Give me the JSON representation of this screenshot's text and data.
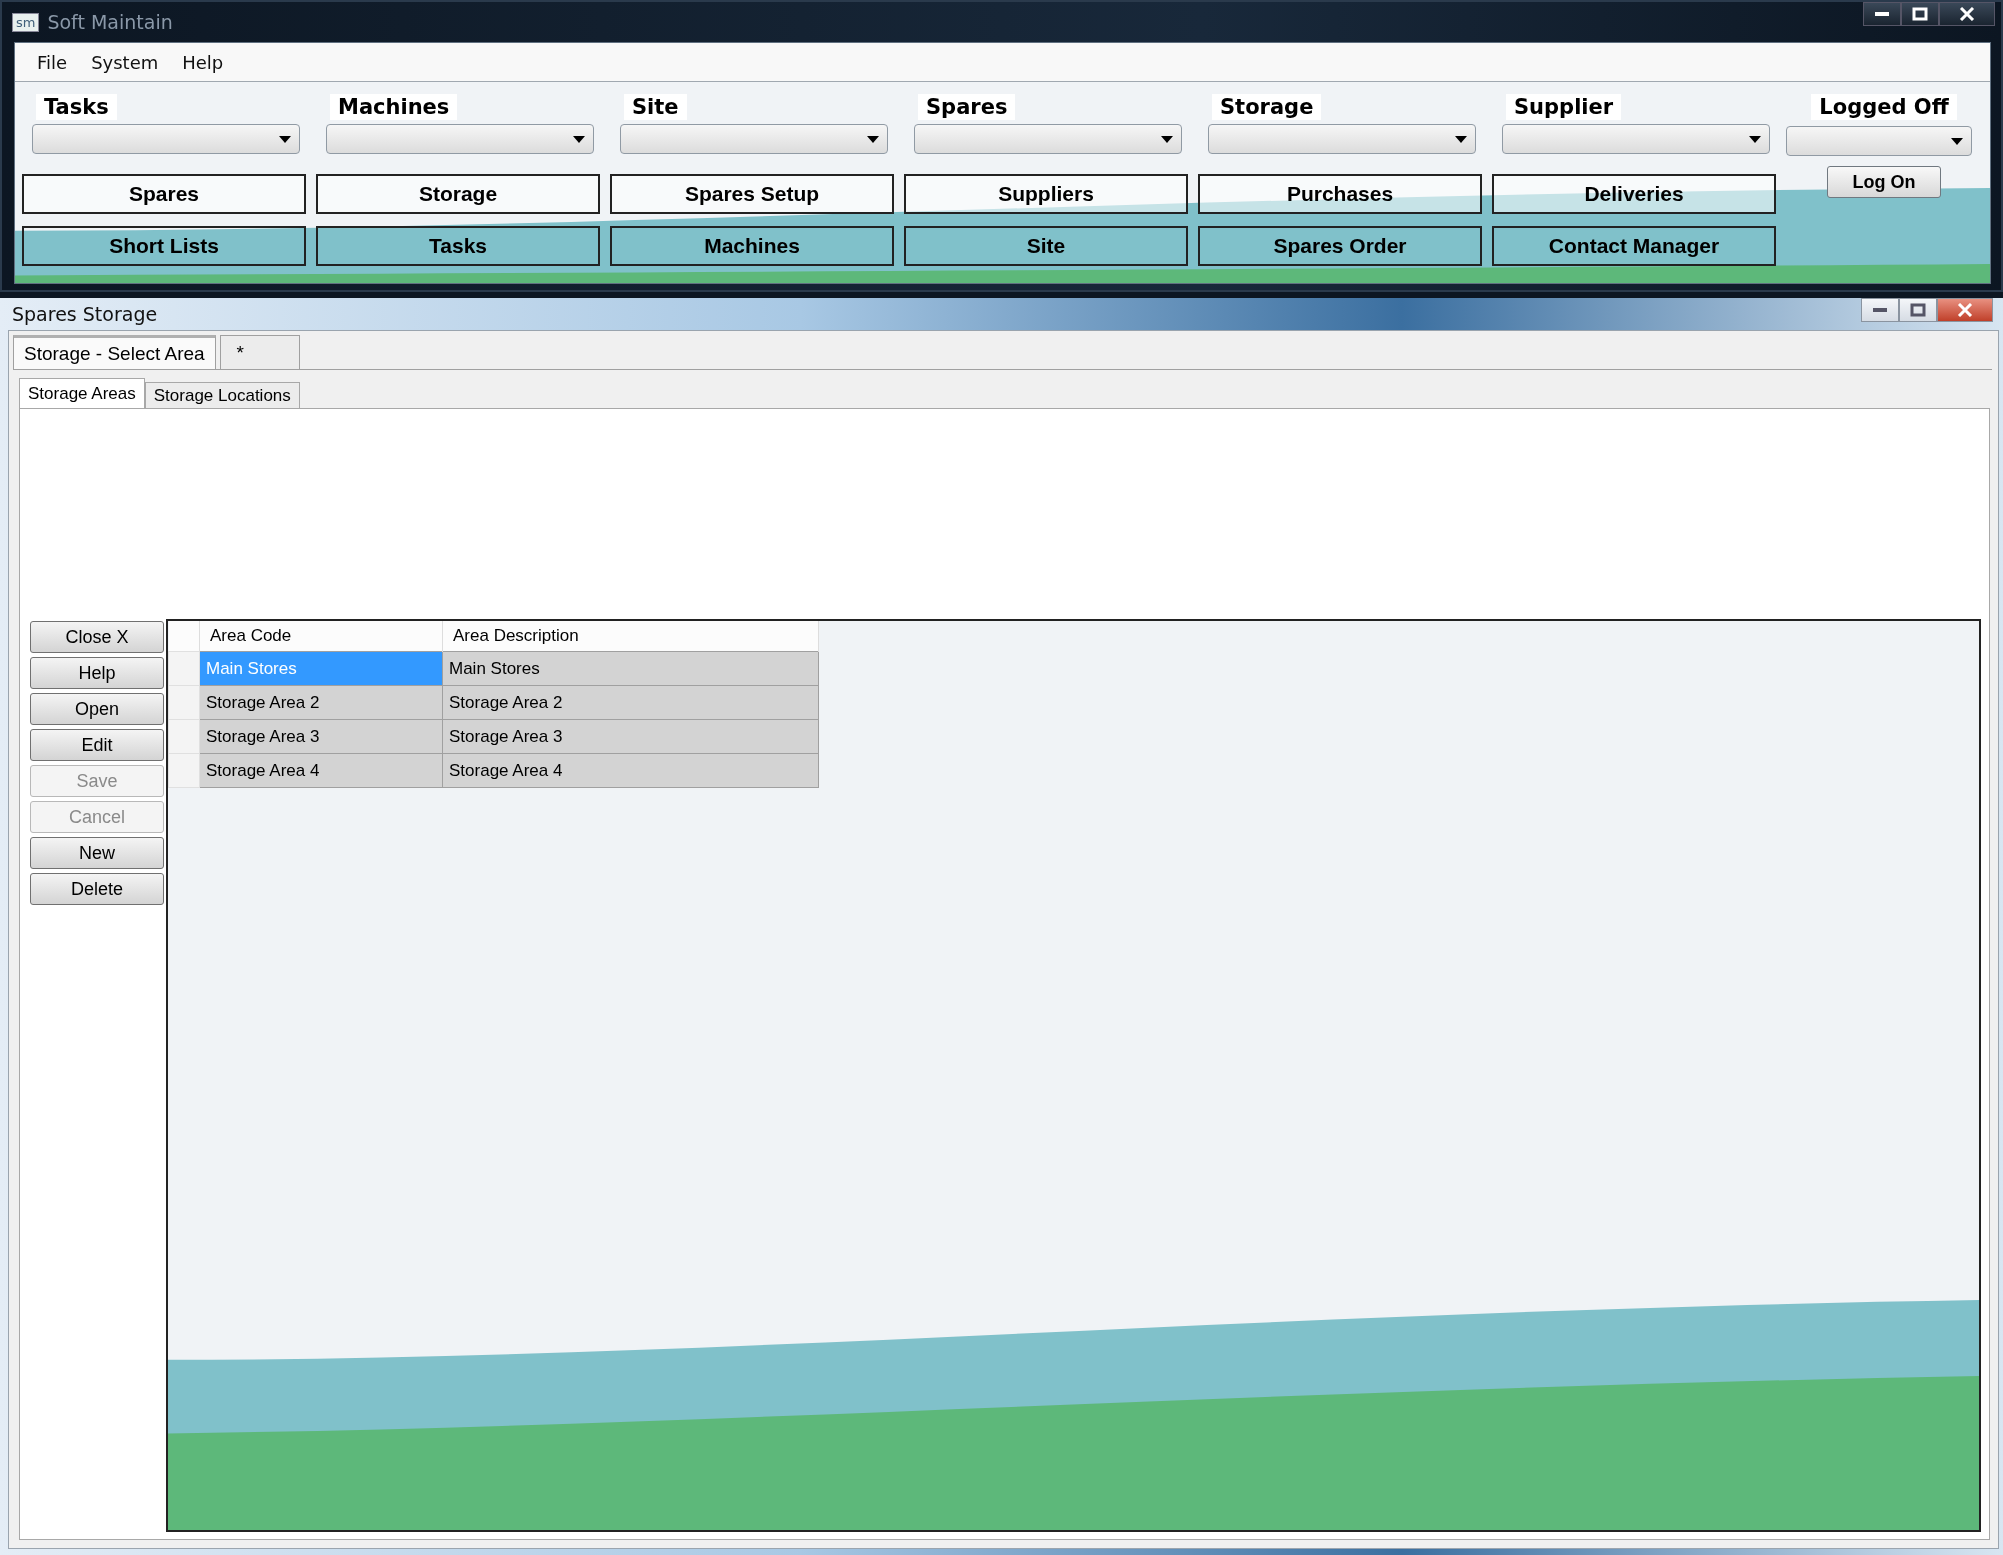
{
  "main_window": {
    "title": "Soft Maintain",
    "app_icon_text": "sm",
    "menu": [
      "File",
      "System",
      "Help"
    ],
    "selectors": [
      {
        "label": "Tasks"
      },
      {
        "label": "Machines"
      },
      {
        "label": "Site"
      },
      {
        "label": "Spares"
      },
      {
        "label": "Storage"
      },
      {
        "label": "Supplier"
      }
    ],
    "login": {
      "status": "Logged Off",
      "button": "Log On"
    },
    "nav_rows": [
      [
        "Spares",
        "Storage",
        "Spares Setup",
        "Suppliers",
        "Purchases",
        "Deliveries"
      ],
      [
        "Short Lists",
        "Tasks",
        "Machines",
        "Site",
        "Spares Order",
        "Contact Manager"
      ]
    ]
  },
  "child_window": {
    "title": "Spares Storage",
    "doc_tabs": [
      {
        "label": "Storage - Select Area",
        "selected": true
      },
      {
        "label": "*",
        "selected": false
      }
    ],
    "sub_tabs": [
      {
        "label": "Storage Areas",
        "selected": true
      },
      {
        "label": "Storage Locations",
        "selected": false
      }
    ],
    "actions": [
      {
        "label": "Close X",
        "disabled": false
      },
      {
        "label": "Help",
        "disabled": false
      },
      {
        "label": "Open",
        "disabled": false
      },
      {
        "label": "Edit",
        "disabled": false
      },
      {
        "label": "Save",
        "disabled": true
      },
      {
        "label": "Cancel",
        "disabled": true
      },
      {
        "label": "New",
        "disabled": false
      },
      {
        "label": "Delete",
        "disabled": false
      }
    ],
    "table": {
      "columns": [
        "Area Code",
        "Area Description"
      ],
      "rows": [
        {
          "cells": [
            "Main Stores",
            "Main Stores"
          ],
          "selected": true
        },
        {
          "cells": [
            "Storage Area 2",
            "Storage Area 2"
          ],
          "selected": false
        },
        {
          "cells": [
            "Storage Area 3",
            "Storage Area 3"
          ],
          "selected": false
        },
        {
          "cells": [
            "Storage Area 4",
            "Storage Area 4"
          ],
          "selected": false
        }
      ]
    }
  }
}
